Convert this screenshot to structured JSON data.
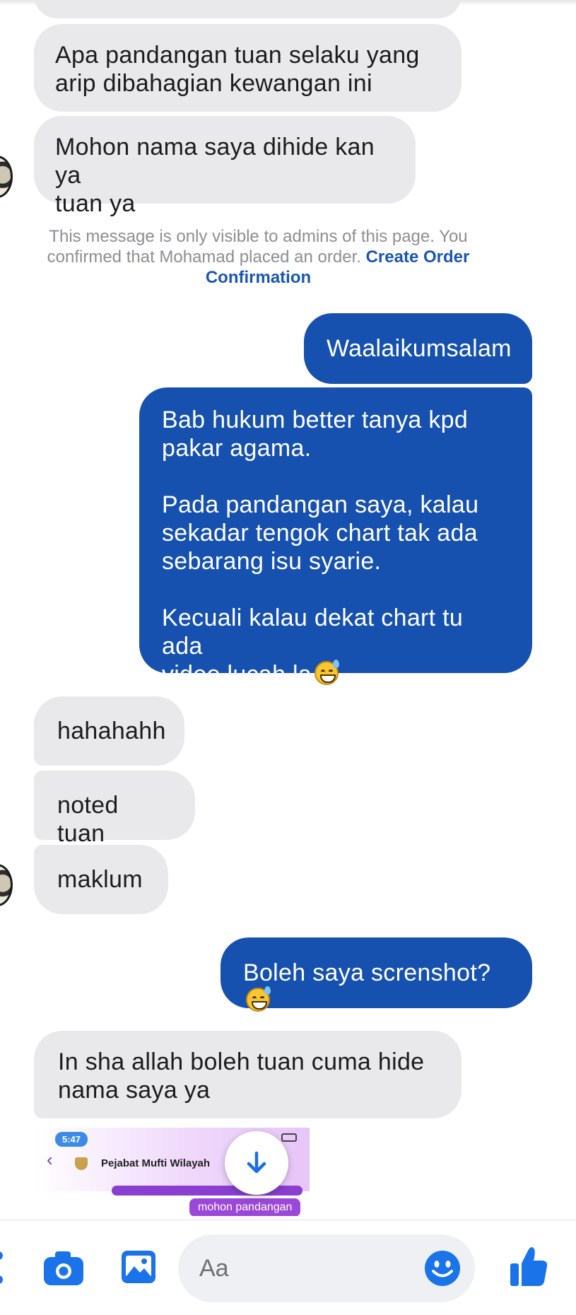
{
  "messages": [
    {
      "side": "in",
      "text": "Apa pandangan tuan selaku yang\narip dibahagian kewangan ini"
    },
    {
      "side": "in",
      "text": "Mohon nama saya dihide kan ya\ntuan ya"
    },
    {
      "side": "out",
      "text": "Waalaikumsalam"
    },
    {
      "side": "out",
      "text": "Bab hukum better tanya kpd\npakar agama.\n\nPada pandangan saya, kalau\nsekadar tengok chart tak ada\nsebarang isu syarie.\n\nKecuali kalau dekat chart tu ada\nvideo lucah la"
    },
    {
      "side": "in",
      "text": "hahahahh"
    },
    {
      "side": "in",
      "text": "noted tuan"
    },
    {
      "side": "in",
      "text": "maklum"
    },
    {
      "side": "out",
      "text": "Boleh saya screnshot?"
    },
    {
      "side": "in",
      "text": "In sha allah boleh tuan cuma hide\nnama saya ya"
    }
  ],
  "notice": {
    "text": "This message is only visible to admins of this page. You confirmed that Mohamad placed an order.",
    "link": "Create Order Confirmation"
  },
  "attachment": {
    "time": "5:47",
    "title": "Pejabat Mufti Wilayah",
    "chip": "mohon pandangan"
  },
  "composer": {
    "placeholder": "Aa",
    "icons": [
      "more-icon",
      "camera-icon",
      "gallery-icon",
      "emoji-icon",
      "thumbs-up-icon"
    ]
  },
  "colors": {
    "outgoing": "#1651b0",
    "incoming": "#e9e9eb",
    "accent": "#1a56b5"
  }
}
